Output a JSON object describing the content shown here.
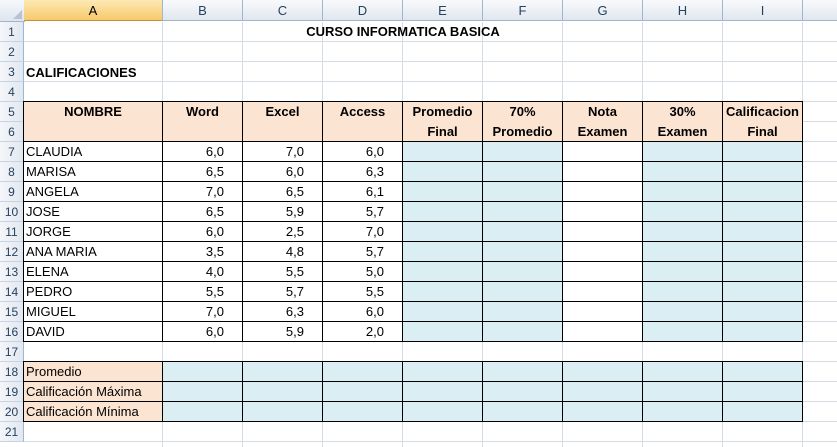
{
  "columns": [
    "A",
    "B",
    "C",
    "D",
    "E",
    "F",
    "G",
    "H",
    "I"
  ],
  "rows": [
    "1",
    "2",
    "3",
    "4",
    "5",
    "6",
    "7",
    "8",
    "9",
    "10",
    "11",
    "12",
    "13",
    "14",
    "15",
    "16",
    "17",
    "18",
    "19",
    "20",
    "21"
  ],
  "title": "CURSO INFORMATICA BASICA",
  "subtitle": "CALIFICACIONES",
  "headers": {
    "nombre": "NOMBRE",
    "word": "Word",
    "excel": "Excel",
    "access": "Access",
    "promedio_l1": "Promedio",
    "promedio_l2": "Final",
    "p70_l1": "70%",
    "p70_l2": "Promedio",
    "nota_l1": "Nota",
    "nota_l2": "Examen",
    "p30_l1": "30%",
    "p30_l2": "Examen",
    "calif_l1": "Calificacion",
    "calif_l2": "Final"
  },
  "students": [
    {
      "name": "CLAUDIA",
      "word": "6,0",
      "excel": "7,0",
      "access": "6,0"
    },
    {
      "name": "MARISA",
      "word": "6,5",
      "excel": "6,0",
      "access": "6,3"
    },
    {
      "name": "ANGELA",
      "word": "7,0",
      "excel": "6,5",
      "access": "6,1"
    },
    {
      "name": "JOSE",
      "word": "6,5",
      "excel": "5,9",
      "access": "5,7"
    },
    {
      "name": "JORGE",
      "word": "6,0",
      "excel": "2,5",
      "access": "7,0"
    },
    {
      "name": "ANA MARIA",
      "word": "3,5",
      "excel": "4,8",
      "access": "5,7"
    },
    {
      "name": "ELENA",
      "word": "4,0",
      "excel": "5,5",
      "access": "5,0"
    },
    {
      "name": "PEDRO",
      "word": "5,5",
      "excel": "5,7",
      "access": "5,5"
    },
    {
      "name": "MIGUEL",
      "word": "7,0",
      "excel": "6,3",
      "access": "6,0"
    },
    {
      "name": "DAVID",
      "word": "6,0",
      "excel": "5,9",
      "access": "2,0"
    }
  ],
  "summary": [
    "Promedio",
    "Calificación Máxima",
    "Calificación Mínima"
  ],
  "colors": {
    "header_fill": "#fce4d2",
    "result_fill": "#dbeef3",
    "active_col": "#f7c96b"
  }
}
